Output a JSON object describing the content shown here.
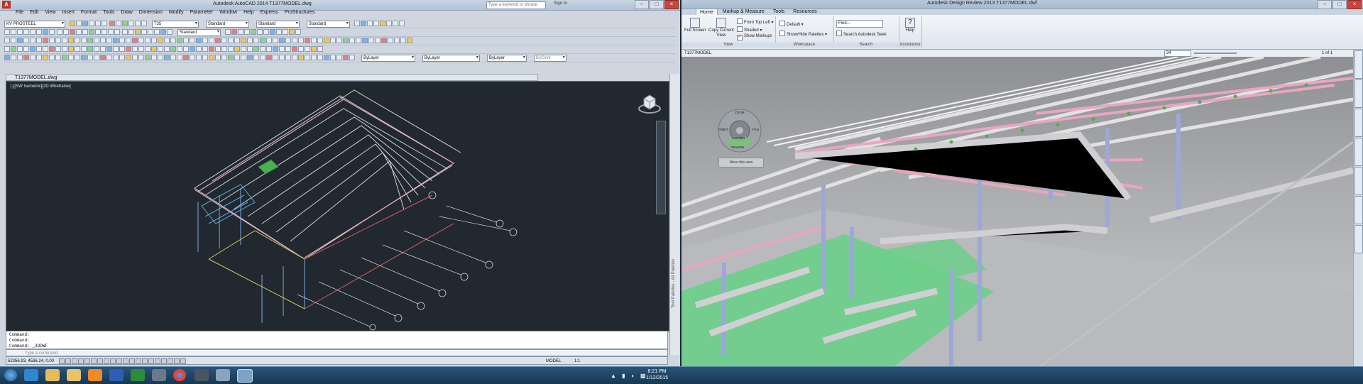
{
  "acad": {
    "title": "Autodesk AutoCAD 2014    T1377MODEL.dwg",
    "search_placeholder": "Type a keyword or phrase",
    "sign_in": "Sign In",
    "workspace": "KV PROSTEEL",
    "menus": [
      "File",
      "Edit",
      "View",
      "Insert",
      "Format",
      "Tools",
      "Draw",
      "Dimension",
      "Modify",
      "Parameter",
      "Window",
      "Help",
      "Express",
      "ProStructures"
    ],
    "combos": {
      "text_style": "Standard",
      "dim_style": "Standard",
      "table_style": "Standard",
      "mleader_style": "Standard",
      "layer": "T35",
      "color": "ByLayer",
      "linetype": "ByLayer",
      "lineweight": "ByLayer",
      "plotstyle": "ByColor"
    },
    "drawing_tab": "T1377MODEL.dwg",
    "viewport_label": "[-][SW Isometric][2D Wireframe]",
    "palette_label": "Tool Palettes - All Palettes",
    "command_lines": [
      "Command:",
      "Command:",
      "Command: _3DDWF"
    ],
    "command_placeholder": "Type a command",
    "status_coords": "52356.93, 4536.24, 0.00",
    "status_model": "MODEL",
    "status_scale": "1:1"
  },
  "dr": {
    "title": "Autodesk Design Review 2013    T1377MODEL.dwf",
    "tabs": [
      "Home",
      "Markup & Measure",
      "Tools",
      "Resources"
    ],
    "groups": {
      "view": "View",
      "workspace": "Workspace",
      "search": "Search",
      "assistance": "Assistance"
    },
    "buttons": {
      "full_screen": "Full Screen",
      "copy_current_view": "Copy Current View",
      "front_top_left": "Front Top Left",
      "shaded": "Shaded",
      "show_markups": "Show Markups",
      "default": "Default",
      "show_hide_palettes": "Show/Hide Palettes",
      "find": "Find...",
      "search_seek": "Search Autodesk Seek",
      "help": "Help"
    },
    "doc_name": "T1377MODEL",
    "zoom_value": "34",
    "page_indicator": "1 of 1",
    "steering": {
      "zoom": "ZOOM",
      "orbit": "ORBIT",
      "pan": "PAN",
      "rewind": "REWIND",
      "center": "CENTER",
      "tooltip": "Move this view"
    },
    "side_tabs": [
      "Sheet Properties",
      "Object Properties",
      "Views",
      "Cross Sections",
      "Layers",
      "Grid Data",
      "Clash Data"
    ]
  },
  "taskbar": {
    "time": "8:21 PM",
    "date": "1/12/2015"
  },
  "colors": {
    "viewport_bg": "#212830",
    "ribbon_bg": "#e8eef5",
    "taskbar_bg": "#1e476a",
    "steel_pink": "#e8a6c0",
    "floor_green": "#6ccf8a"
  }
}
